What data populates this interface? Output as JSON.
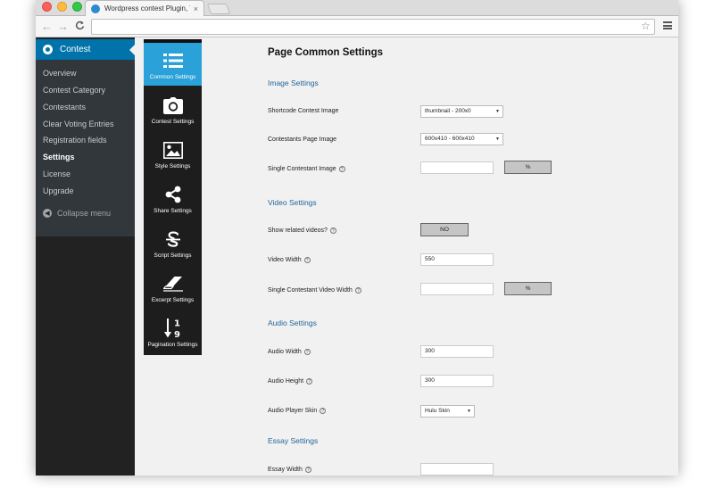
{
  "browser": {
    "tab_title": "Wordpress contest Plugin, W",
    "tab_close": "×",
    "url": "",
    "back": "←",
    "forward": "→",
    "reload": "C",
    "star": "☆"
  },
  "wp_menu": {
    "header": "Contest",
    "items": [
      {
        "label": "Overview"
      },
      {
        "label": "Contest Category"
      },
      {
        "label": "Contestants"
      },
      {
        "label": "Clear Voting Entries"
      },
      {
        "label": "Registration fields"
      },
      {
        "label": "Settings",
        "active": true
      },
      {
        "label": "License"
      },
      {
        "label": "Upgrade"
      }
    ],
    "collapse": "Collapse menu"
  },
  "plugin_tabs": [
    {
      "label": "Common Settings",
      "icon": "list-icon",
      "active": true
    },
    {
      "label": "Contest Settings",
      "icon": "camera-icon"
    },
    {
      "label": "Style Settings",
      "icon": "image-icon"
    },
    {
      "label": "Share Settings",
      "icon": "share-icon"
    },
    {
      "label": "Script Settings",
      "icon": "strikethrough-s-icon"
    },
    {
      "label": "Excerpt Settings",
      "icon": "eraser-icon"
    },
    {
      "label": "Pagination Settings",
      "icon": "sort-numeric-icon"
    }
  ],
  "pagination_icon_digits": {
    "top": "1",
    "bottom": "9"
  },
  "main": {
    "title": "Page Common Settings",
    "image_section": {
      "title": "Image Settings",
      "shortcode_label": "Shortcode Contest Image",
      "shortcode_value": "thumbnail - 200x0",
      "contestants_label": "Contestants Page Image",
      "contestants_value": "600x410 - 600x410",
      "single_label": "Single Contestant Image",
      "single_value": "",
      "single_btn": "%"
    },
    "video_section": {
      "title": "Video Settings",
      "related_label": "Show related videos?",
      "related_btn": "NO",
      "width_label": "Video Width",
      "width_value": "550",
      "single_label": "Single Contestant Video Width",
      "single_value": "",
      "single_btn": "%"
    },
    "audio_section": {
      "title": "Audio Settings",
      "width_label": "Audio Width",
      "width_value": "300",
      "height_label": "Audio Height",
      "height_value": "300",
      "skin_label": "Audio Player Skin",
      "skin_value": "Hulu Skin"
    },
    "essay_section": {
      "title": "Essay Settings",
      "width_label": "Essay Width",
      "width_value": ""
    },
    "help_glyph": "?",
    "caret_glyph": "▼"
  },
  "colors": {
    "wp_accent": "#0073aa",
    "plugin_active": "#2aa1d8",
    "section_title": "#23679a"
  }
}
